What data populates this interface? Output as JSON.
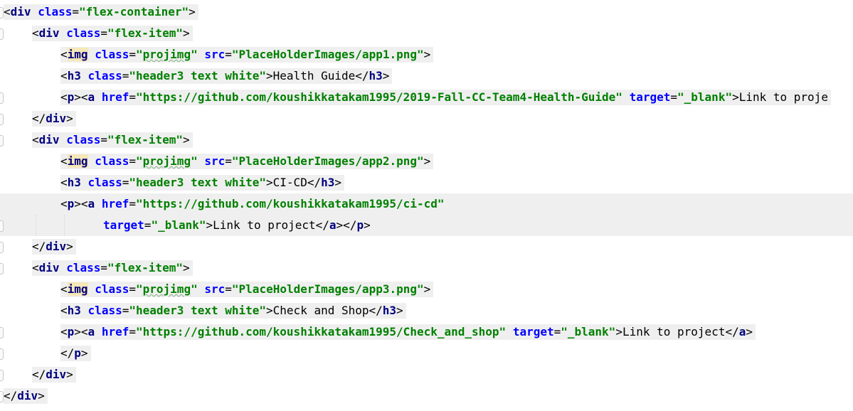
{
  "editor": {
    "lines": [
      {
        "indent": 0,
        "tokens": [
          {
            "t": "<",
            "k": "punc"
          },
          {
            "t": "div",
            "k": "tag"
          },
          {
            "t": " ",
            "k": "text"
          },
          {
            "t": "class",
            "k": "attr"
          },
          {
            "t": "=",
            "k": "punc"
          },
          {
            "t": "\"flex-container\"",
            "k": "val"
          },
          {
            "t": ">",
            "k": "punc"
          }
        ]
      },
      {
        "indent": 1,
        "tokens": [
          {
            "t": "<",
            "k": "punc"
          },
          {
            "t": "div",
            "k": "tag"
          },
          {
            "t": " ",
            "k": "text"
          },
          {
            "t": "class",
            "k": "attr"
          },
          {
            "t": "=",
            "k": "punc"
          },
          {
            "t": "\"flex-item\"",
            "k": "val"
          },
          {
            "t": ">",
            "k": "punc"
          }
        ]
      },
      {
        "indent": 2,
        "tokens": [
          {
            "t": "<",
            "k": "punc"
          },
          {
            "t": "img",
            "k": "tag",
            "hl": true
          },
          {
            "t": " ",
            "k": "text"
          },
          {
            "t": "class",
            "k": "attr"
          },
          {
            "t": "=",
            "k": "punc"
          },
          {
            "t": "\"",
            "k": "val"
          },
          {
            "t": "projimg",
            "k": "val",
            "wave": true
          },
          {
            "t": "\"",
            "k": "val"
          },
          {
            "t": " ",
            "k": "text"
          },
          {
            "t": "src",
            "k": "attr"
          },
          {
            "t": "=",
            "k": "punc"
          },
          {
            "t": "\"PlaceHolderImages/app1.png\"",
            "k": "val"
          },
          {
            "t": ">",
            "k": "punc"
          }
        ]
      },
      {
        "indent": 2,
        "tokens": [
          {
            "t": "<",
            "k": "punc"
          },
          {
            "t": "h3",
            "k": "tag"
          },
          {
            "t": " ",
            "k": "text"
          },
          {
            "t": "class",
            "k": "attr"
          },
          {
            "t": "=",
            "k": "punc"
          },
          {
            "t": "\"header3 text white\"",
            "k": "val"
          },
          {
            "t": ">",
            "k": "punc"
          },
          {
            "t": "Health Guide",
            "k": "text"
          },
          {
            "t": "</",
            "k": "punc"
          },
          {
            "t": "h3",
            "k": "tag"
          },
          {
            "t": ">",
            "k": "punc"
          }
        ]
      },
      {
        "indent": 2,
        "tokens": [
          {
            "t": "<",
            "k": "punc"
          },
          {
            "t": "p",
            "k": "tag"
          },
          {
            "t": "><",
            "k": "punc"
          },
          {
            "t": "a",
            "k": "tag"
          },
          {
            "t": " ",
            "k": "text"
          },
          {
            "t": "href",
            "k": "attr"
          },
          {
            "t": "=",
            "k": "punc"
          },
          {
            "t": "\"https://github.com/koushikkatakam1995/2019-Fall-CC-Team4-Health-Guide\"",
            "k": "val"
          },
          {
            "t": " ",
            "k": "text"
          },
          {
            "t": "target",
            "k": "attr"
          },
          {
            "t": "=",
            "k": "punc"
          },
          {
            "t": "\"_blank\"",
            "k": "val"
          },
          {
            "t": ">",
            "k": "punc"
          },
          {
            "t": "Link to proje",
            "k": "text"
          }
        ]
      },
      {
        "indent": 1,
        "tokens": [
          {
            "t": "</",
            "k": "punc"
          },
          {
            "t": "div",
            "k": "tag"
          },
          {
            "t": ">",
            "k": "punc"
          }
        ]
      },
      {
        "indent": 1,
        "tokens": [
          {
            "t": "<",
            "k": "punc"
          },
          {
            "t": "div",
            "k": "tag"
          },
          {
            "t": " ",
            "k": "text"
          },
          {
            "t": "class",
            "k": "attr"
          },
          {
            "t": "=",
            "k": "punc"
          },
          {
            "t": "\"flex-item\"",
            "k": "val"
          },
          {
            "t": ">",
            "k": "punc"
          }
        ]
      },
      {
        "indent": 2,
        "tokens": [
          {
            "t": "<",
            "k": "punc"
          },
          {
            "t": "img",
            "k": "tag",
            "hl": true
          },
          {
            "t": " ",
            "k": "text"
          },
          {
            "t": "class",
            "k": "attr"
          },
          {
            "t": "=",
            "k": "punc"
          },
          {
            "t": "\"",
            "k": "val"
          },
          {
            "t": "projimg",
            "k": "val",
            "wave": true
          },
          {
            "t": "\"",
            "k": "val"
          },
          {
            "t": " ",
            "k": "text"
          },
          {
            "t": "src",
            "k": "attr"
          },
          {
            "t": "=",
            "k": "punc"
          },
          {
            "t": "\"PlaceHolderImages/app2.png\"",
            "k": "val"
          },
          {
            "t": ">",
            "k": "punc"
          }
        ]
      },
      {
        "indent": 2,
        "tokens": [
          {
            "t": "<",
            "k": "punc"
          },
          {
            "t": "h3",
            "k": "tag"
          },
          {
            "t": " ",
            "k": "text"
          },
          {
            "t": "class",
            "k": "attr"
          },
          {
            "t": "=",
            "k": "punc"
          },
          {
            "t": "\"header3 text white\"",
            "k": "val"
          },
          {
            "t": ">",
            "k": "punc"
          },
          {
            "t": "CI-CD",
            "k": "text"
          },
          {
            "t": "</",
            "k": "punc"
          },
          {
            "t": "h3",
            "k": "tag"
          },
          {
            "t": ">",
            "k": "punc"
          }
        ]
      },
      {
        "indent": 2,
        "current": true,
        "tokens": [
          {
            "t": "<",
            "k": "punc"
          },
          {
            "t": "p",
            "k": "tag"
          },
          {
            "t": "><",
            "k": "punc"
          },
          {
            "t": "a",
            "k": "tag"
          },
          {
            "t": " ",
            "k": "text"
          },
          {
            "t": "href",
            "k": "attr"
          },
          {
            "t": "=",
            "k": "punc"
          },
          {
            "t": "\"https://github.com/koushikkatakam1995/ci-cd\"",
            "k": "val"
          }
        ]
      },
      {
        "indent": 3.5,
        "current": true,
        "tokens": [
          {
            "t": "target",
            "k": "attr"
          },
          {
            "t": "=",
            "k": "punc"
          },
          {
            "t": "\"_blank\"",
            "k": "val"
          },
          {
            "t": ">",
            "k": "punc"
          },
          {
            "t": "Link to project",
            "k": "text"
          },
          {
            "t": "</",
            "k": "punc"
          },
          {
            "t": "a",
            "k": "tag"
          },
          {
            "t": "></",
            "k": "punc"
          },
          {
            "t": "p",
            "k": "tag"
          },
          {
            "t": ">",
            "k": "punc"
          }
        ]
      },
      {
        "indent": 1,
        "tokens": [
          {
            "t": "</",
            "k": "punc"
          },
          {
            "t": "div",
            "k": "tag"
          },
          {
            "t": ">",
            "k": "punc"
          }
        ]
      },
      {
        "indent": 1,
        "tokens": [
          {
            "t": "<",
            "k": "punc"
          },
          {
            "t": "div",
            "k": "tag"
          },
          {
            "t": " ",
            "k": "text"
          },
          {
            "t": "class",
            "k": "attr"
          },
          {
            "t": "=",
            "k": "punc"
          },
          {
            "t": "\"flex-item\"",
            "k": "val"
          },
          {
            "t": ">",
            "k": "punc"
          }
        ]
      },
      {
        "indent": 2,
        "tokens": [
          {
            "t": "<",
            "k": "punc"
          },
          {
            "t": "img",
            "k": "tag",
            "hl": true
          },
          {
            "t": " ",
            "k": "text"
          },
          {
            "t": "class",
            "k": "attr"
          },
          {
            "t": "=",
            "k": "punc"
          },
          {
            "t": "\"",
            "k": "val"
          },
          {
            "t": "projimg",
            "k": "val",
            "wave": true
          },
          {
            "t": "\"",
            "k": "val"
          },
          {
            "t": " ",
            "k": "text"
          },
          {
            "t": "src",
            "k": "attr"
          },
          {
            "t": "=",
            "k": "punc"
          },
          {
            "t": "\"PlaceHolderImages/app3.png\"",
            "k": "val"
          },
          {
            "t": ">",
            "k": "punc"
          }
        ]
      },
      {
        "indent": 2,
        "tokens": [
          {
            "t": "<",
            "k": "punc"
          },
          {
            "t": "h3",
            "k": "tag"
          },
          {
            "t": " ",
            "k": "text"
          },
          {
            "t": "class",
            "k": "attr"
          },
          {
            "t": "=",
            "k": "punc"
          },
          {
            "t": "\"header3 text white\"",
            "k": "val"
          },
          {
            "t": ">",
            "k": "punc"
          },
          {
            "t": "Check and Shop",
            "k": "text"
          },
          {
            "t": "</",
            "k": "punc"
          },
          {
            "t": "h3",
            "k": "tag"
          },
          {
            "t": ">",
            "k": "punc"
          }
        ]
      },
      {
        "indent": 2,
        "tokens": [
          {
            "t": "<",
            "k": "punc"
          },
          {
            "t": "p",
            "k": "tag"
          },
          {
            "t": "><",
            "k": "punc"
          },
          {
            "t": "a",
            "k": "tag"
          },
          {
            "t": " ",
            "k": "text"
          },
          {
            "t": "href",
            "k": "attr"
          },
          {
            "t": "=",
            "k": "punc"
          },
          {
            "t": "\"https://github.com/koushikkatakam1995/Check_and_shop\"",
            "k": "val"
          },
          {
            "t": " ",
            "k": "text"
          },
          {
            "t": "target",
            "k": "attr"
          },
          {
            "t": "=",
            "k": "punc"
          },
          {
            "t": "\"_blank\"",
            "k": "val"
          },
          {
            "t": ">",
            "k": "punc"
          },
          {
            "t": "Link to project",
            "k": "text"
          },
          {
            "t": "</",
            "k": "punc"
          },
          {
            "t": "a",
            "k": "tag"
          },
          {
            "t": ">",
            "k": "punc"
          }
        ]
      },
      {
        "indent": 2,
        "tokens": [
          {
            "t": "</",
            "k": "punc"
          },
          {
            "t": "p",
            "k": "tag"
          },
          {
            "t": ">",
            "k": "punc"
          }
        ]
      },
      {
        "indent": 1,
        "tokens": [
          {
            "t": "</",
            "k": "punc"
          },
          {
            "t": "div",
            "k": "tag"
          },
          {
            "t": ">",
            "k": "punc"
          }
        ]
      },
      {
        "indent": 0,
        "tokens": [
          {
            "t": "</",
            "k": "punc"
          },
          {
            "t": "div",
            "k": "tag"
          },
          {
            "t": ">",
            "k": "punc"
          }
        ]
      }
    ],
    "fold_markers": [
      0,
      1,
      4,
      5,
      6,
      10,
      11,
      12,
      15,
      16,
      17,
      18
    ]
  },
  "colors": {
    "tag": "#000080",
    "attr": "#0000ff",
    "val": "#008000",
    "text": "#000000",
    "line_bg": "#efefef",
    "current_line_bg": "#efefef"
  }
}
